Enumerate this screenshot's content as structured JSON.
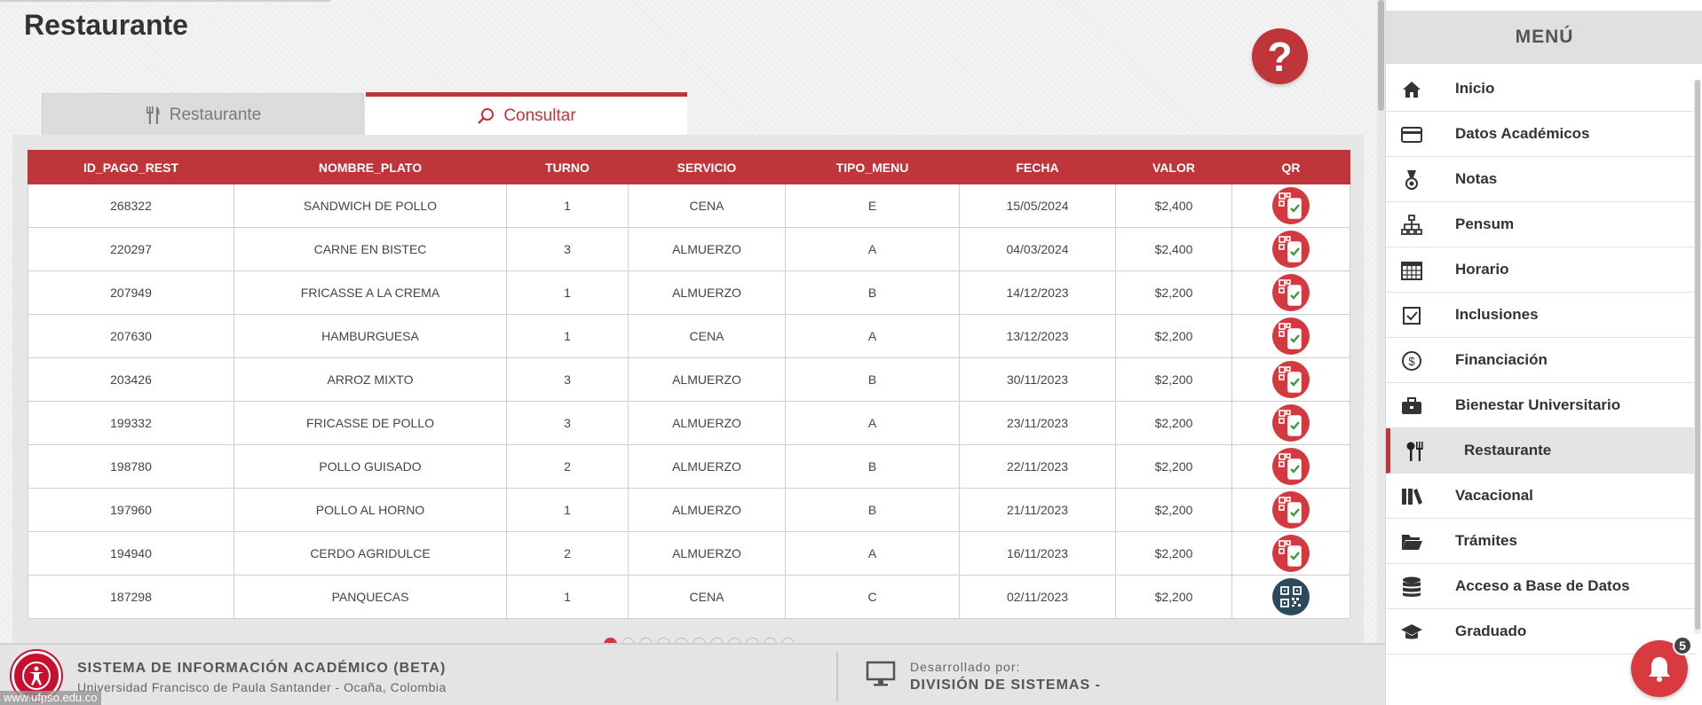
{
  "page": {
    "title": "Restaurante",
    "help_label": "?"
  },
  "tabs": [
    {
      "label": "Restaurante",
      "icon": "utensils-icon",
      "active": false
    },
    {
      "label": "Consultar",
      "icon": "search-icon",
      "active": true
    }
  ],
  "table": {
    "headers": [
      "ID_PAGO_REST",
      "NOMBRE_PLATO",
      "TURNO",
      "SERVICIO",
      "TIPO_MENU",
      "FECHA",
      "VALOR",
      "QR"
    ],
    "rows": [
      {
        "id": "268322",
        "plato": "SANDWICH DE POLLO",
        "turno": "1",
        "servicio": "CENA",
        "tipo": "E",
        "fecha": "15/05/2024",
        "valor": "$2,400",
        "qr": "qr-used-icon"
      },
      {
        "id": "220297",
        "plato": "CARNE EN BISTEC",
        "turno": "3",
        "servicio": "ALMUERZO",
        "tipo": "A",
        "fecha": "04/03/2024",
        "valor": "$2,400",
        "qr": "qr-used-icon"
      },
      {
        "id": "207949",
        "plato": "FRICASSE A LA CREMA",
        "turno": "1",
        "servicio": "ALMUERZO",
        "tipo": "B",
        "fecha": "14/12/2023",
        "valor": "$2,200",
        "qr": "qr-used-icon"
      },
      {
        "id": "207630",
        "plato": "HAMBURGUESA",
        "turno": "1",
        "servicio": "CENA",
        "tipo": "A",
        "fecha": "13/12/2023",
        "valor": "$2,200",
        "qr": "qr-used-icon"
      },
      {
        "id": "203426",
        "plato": "ARROZ MIXTO",
        "turno": "3",
        "servicio": "ALMUERZO",
        "tipo": "B",
        "fecha": "30/11/2023",
        "valor": "$2,200",
        "qr": "qr-used-icon"
      },
      {
        "id": "199332",
        "plato": "FRICASSE DE POLLO",
        "turno": "3",
        "servicio": "ALMUERZO",
        "tipo": "A",
        "fecha": "23/11/2023",
        "valor": "$2,200",
        "qr": "qr-used-icon"
      },
      {
        "id": "198780",
        "plato": "POLLO GUISADO",
        "turno": "2",
        "servicio": "ALMUERZO",
        "tipo": "B",
        "fecha": "22/11/2023",
        "valor": "$2,200",
        "qr": "qr-used-icon"
      },
      {
        "id": "197960",
        "plato": "POLLO AL HORNO",
        "turno": "1",
        "servicio": "ALMUERZO",
        "tipo": "B",
        "fecha": "21/11/2023",
        "valor": "$2,200",
        "qr": "qr-used-icon"
      },
      {
        "id": "194940",
        "plato": "CERDO AGRIDULCE",
        "turno": "2",
        "servicio": "ALMUERZO",
        "tipo": "A",
        "fecha": "16/11/2023",
        "valor": "$2,200",
        "qr": "qr-used-icon"
      },
      {
        "id": "187298",
        "plato": "PANQUECAS",
        "turno": "1",
        "servicio": "CENA",
        "tipo": "C",
        "fecha": "02/11/2023",
        "valor": "$2,200",
        "qr": "qr-code-icon"
      }
    ]
  },
  "pager": {
    "pages": 11,
    "current": 1
  },
  "footer": {
    "system_name": "SISTEMA DE INFORMACIÓN ACADÉMICO (BETA)",
    "university": "Universidad Francisco de Paula Santander - Ocaña, Colombia",
    "developed_by": "Desarrollado por:",
    "division": "DIVISIÓN DE SISTEMAS -",
    "url": "www.ufpso.edu.co"
  },
  "menu": {
    "title": "MENÚ",
    "items": [
      {
        "label": "Inicio",
        "icon": "home-icon"
      },
      {
        "label": "Datos Académicos",
        "icon": "credit-card-icon"
      },
      {
        "label": "Notas",
        "icon": "medal-icon"
      },
      {
        "label": "Pensum",
        "icon": "sitemap-icon"
      },
      {
        "label": "Horario",
        "icon": "calendar-icon"
      },
      {
        "label": "Inclusiones",
        "icon": "checkbox-icon"
      },
      {
        "label": "Financiación",
        "icon": "dollar-circle-icon"
      },
      {
        "label": "Bienestar Universitario",
        "icon": "briefcase-icon"
      },
      {
        "label": "Restaurante",
        "icon": "utensils-icon",
        "active": true
      },
      {
        "label": "Vacacional",
        "icon": "books-icon"
      },
      {
        "label": "Trámites",
        "icon": "folder-open-icon"
      },
      {
        "label": "Acceso a Base de Datos",
        "icon": "database-icon"
      },
      {
        "label": "Graduado",
        "icon": "graduation-cap-icon"
      }
    ]
  },
  "notifications": {
    "count": "5"
  },
  "colors": {
    "accent": "#c0353a",
    "qr_used": "#d3393f",
    "qr_pending": "#2c4a5e"
  }
}
